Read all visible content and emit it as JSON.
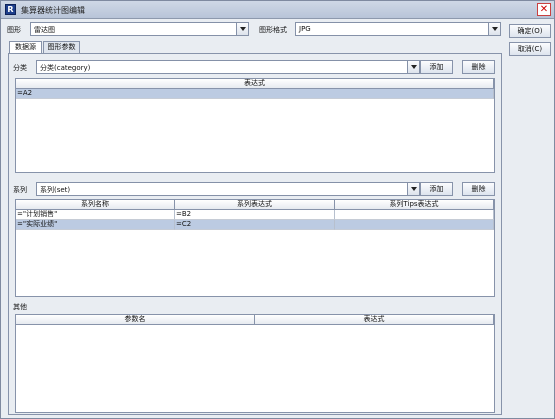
{
  "window": {
    "title": "集算器统计图编辑",
    "close": "✕",
    "app_icon": "R"
  },
  "top": {
    "chart_label": "图形",
    "chart_value": "雷达图",
    "format_label": "图形格式",
    "format_value": "JPG"
  },
  "buttons": {
    "ok": "确定(O)",
    "cancel": "取消(C)"
  },
  "tabs": [
    {
      "label": "数据源"
    },
    {
      "label": "图形参数"
    }
  ],
  "category": {
    "label": "分类",
    "value": "分类(category)",
    "add": "添加",
    "delete": "删除",
    "header": "表达式",
    "rows": [
      "=A2"
    ]
  },
  "series": {
    "label": "系列",
    "value": "系列(set)",
    "add": "添加",
    "delete": "删除",
    "headers": [
      "系列名称",
      "系列表达式",
      "系列Tips表达式"
    ],
    "rows": [
      [
        "=\"计划销售\"",
        "=B2",
        ""
      ],
      [
        "=\"实际业绩\"",
        "=C2",
        ""
      ]
    ]
  },
  "other": {
    "label": "其他",
    "headers": [
      "参数名",
      "表达式"
    ]
  }
}
